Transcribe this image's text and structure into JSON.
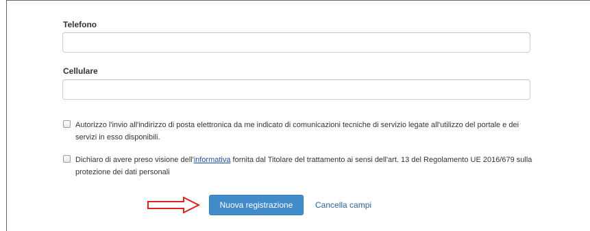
{
  "form": {
    "telefono": {
      "label": "Telefono",
      "value": "",
      "placeholder": ""
    },
    "cellulare": {
      "label": "Cellulare",
      "value": "",
      "placeholder": ""
    },
    "consent_comunicazioni": {
      "checked": false,
      "text": "Autorizzo l'invio all'indirizzo di posta elettronica da me indicato di comunicazioni tecniche di servizio legate all'utilizzo del portale e dei servizi in esso disponibili."
    },
    "consent_privacy": {
      "checked": false,
      "text_before": "Dichiaro di avere preso visione dell'",
      "link_text": "informativa",
      "text_after": " fornita dal Titolare del trattamento ai sensi dell'art. 13 del Regolamento UE 2016/679 sulla protezione dei dati personali"
    },
    "submit_label": "Nuova registrazione",
    "reset_label": "Cancella campi"
  },
  "annotation": {
    "arrow_color": "#e0201b",
    "arrow_icon": "right-arrow-outline"
  },
  "colors": {
    "primary": "#428bca",
    "link": "#2a6496"
  }
}
